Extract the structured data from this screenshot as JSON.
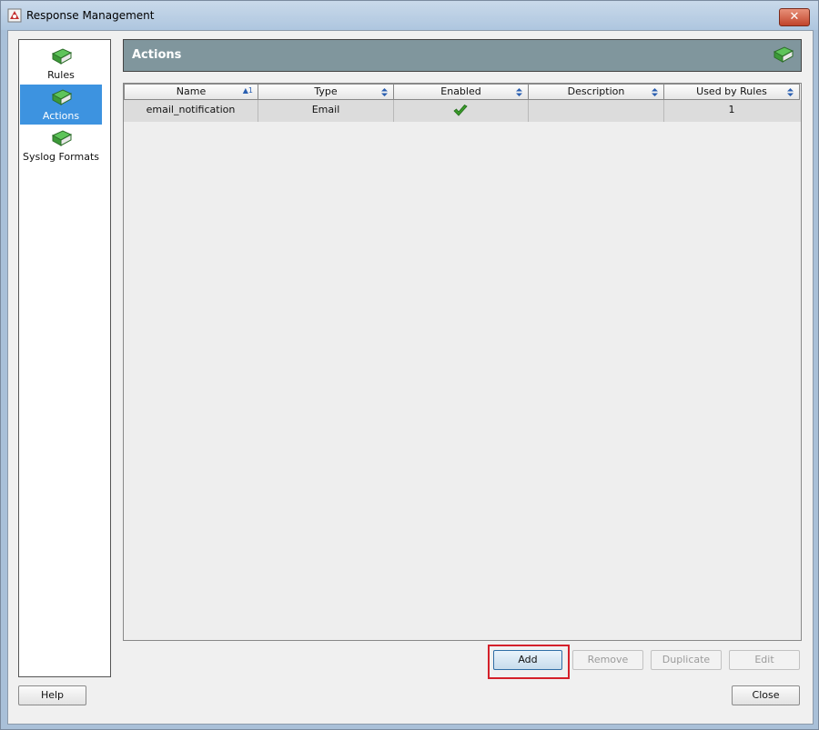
{
  "window": {
    "title": "Response Management",
    "close_glyph": "✕"
  },
  "sidebar": {
    "items": [
      {
        "label": "Rules",
        "icon": "book-icon",
        "selected": false
      },
      {
        "label": "Actions",
        "icon": "book-icon",
        "selected": true
      },
      {
        "label": "Syslog Formats",
        "icon": "book-icon",
        "selected": false
      }
    ]
  },
  "header": {
    "title": "Actions",
    "icon": "book-icon"
  },
  "table": {
    "columns": [
      {
        "label": "Name",
        "sort": "ascending",
        "sort_index": "1"
      },
      {
        "label": "Type",
        "sort": "none"
      },
      {
        "label": "Enabled",
        "sort": "none"
      },
      {
        "label": "Description",
        "sort": "none"
      },
      {
        "label": "Used by Rules",
        "sort": "none"
      }
    ],
    "rows": [
      {
        "name": "email_notification",
        "type": "Email",
        "enabled": true,
        "description": "",
        "used_by_rules": "1"
      }
    ]
  },
  "buttons": {
    "add": "Add",
    "remove": "Remove",
    "duplicate": "Duplicate",
    "edit": "Edit",
    "help": "Help",
    "close": "Close"
  },
  "colors": {
    "selection": "#3d93e0",
    "header_bar": "#80969d",
    "highlight": "#d4202a",
    "check": "#3a9a2a"
  }
}
